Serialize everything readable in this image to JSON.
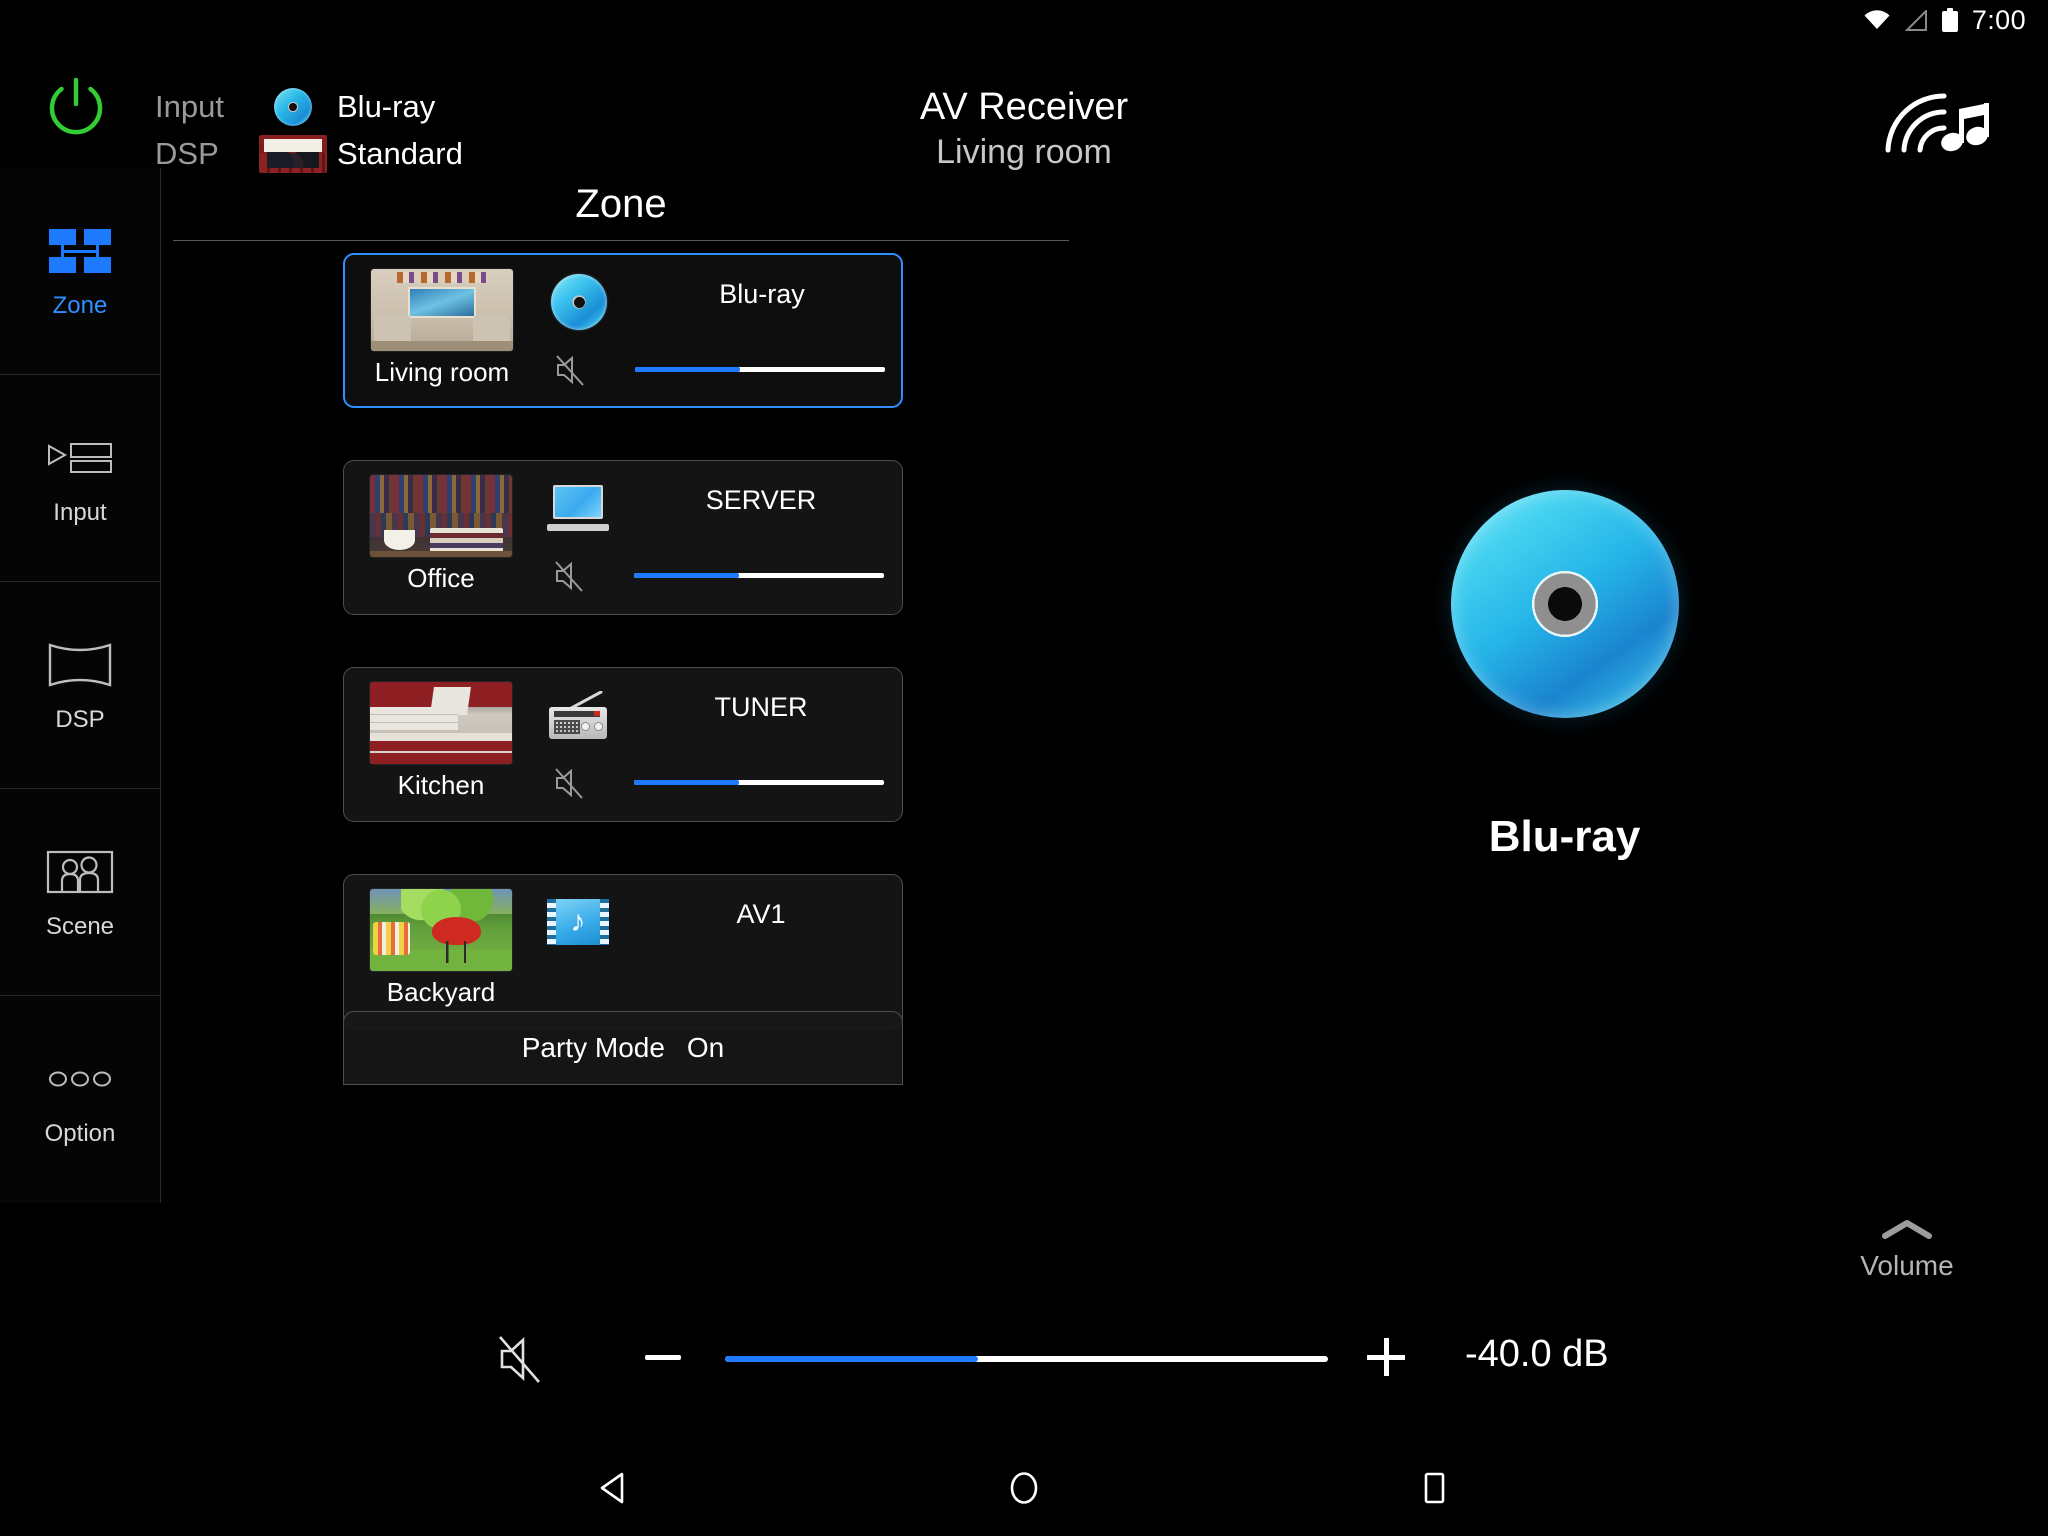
{
  "statusbar": {
    "time": "7:00",
    "icons": [
      "wifi-icon",
      "cell-signal-icon",
      "battery-icon"
    ]
  },
  "header": {
    "power_icon": "power-icon",
    "input_key": "Input",
    "input_value": "Blu-ray",
    "input_icon": "bluray-disc-icon",
    "dsp_key": "DSP",
    "dsp_value": "Standard",
    "dsp_icon": "cinema-thumbnail-icon",
    "title": "AV Receiver",
    "subtitle": "Living room",
    "logo_icon": "musiccast-wireless-icon"
  },
  "sidebar": {
    "items": [
      {
        "label": "Zone",
        "icon": "zone-grid-icon",
        "active": true
      },
      {
        "label": "Input",
        "icon": "input-list-icon",
        "active": false
      },
      {
        "label": "DSP",
        "icon": "dsp-curve-icon",
        "active": false
      },
      {
        "label": "Scene",
        "icon": "scene-people-icon",
        "active": false
      },
      {
        "label": "Option",
        "icon": "option-dots-icon",
        "active": false
      }
    ]
  },
  "panel": {
    "title": "Zone",
    "edit_icon": "pencil-edit-icon",
    "zones": [
      {
        "name": "Living room",
        "source": "Blu-ray",
        "source_icon": "bluray-disc-icon",
        "thumbnail": "living-room-photo",
        "selected": true,
        "muted": true,
        "mute_icon": "mute-icon",
        "volume_percent": 42,
        "has_volume": true
      },
      {
        "name": "Office",
        "source": "SERVER",
        "source_icon": "laptop-icon",
        "thumbnail": "office-bookshelf-photo",
        "selected": false,
        "muted": true,
        "mute_icon": "mute-icon",
        "volume_percent": 42,
        "has_volume": true
      },
      {
        "name": "Kitchen",
        "source": "TUNER",
        "source_icon": "radio-icon",
        "thumbnail": "kitchen-photo",
        "selected": false,
        "muted": true,
        "mute_icon": "mute-icon",
        "volume_percent": 42,
        "has_volume": true
      },
      {
        "name": "Backyard",
        "source": "AV1",
        "source_icon": "film-music-icon",
        "thumbnail": "backyard-grill-photo",
        "selected": false,
        "muted": false,
        "mute_icon": "",
        "volume_percent": 0,
        "has_volume": false
      }
    ],
    "party_mode_label": "Party Mode",
    "party_mode_value": "On"
  },
  "nowplaying": {
    "source_icon": "bluray-disc-large-icon",
    "source_label": "Blu-ray"
  },
  "volume": {
    "toggle_label": "Volume",
    "toggle_icon": "chevron-up-icon",
    "mute_icon": "mute-icon",
    "minus_label": "minus-icon",
    "plus_label": "plus-icon",
    "percent": 42,
    "value": "-40.0 dB"
  },
  "navbar": {
    "back_icon": "android-back-icon",
    "home_icon": "android-home-icon",
    "recents_icon": "android-recents-icon"
  },
  "colors": {
    "accent_blue": "#1e7bff",
    "active_blue": "#2f8fff",
    "power_green": "#33cc33",
    "background": "#000000",
    "card_border": "#4e4e4e"
  }
}
